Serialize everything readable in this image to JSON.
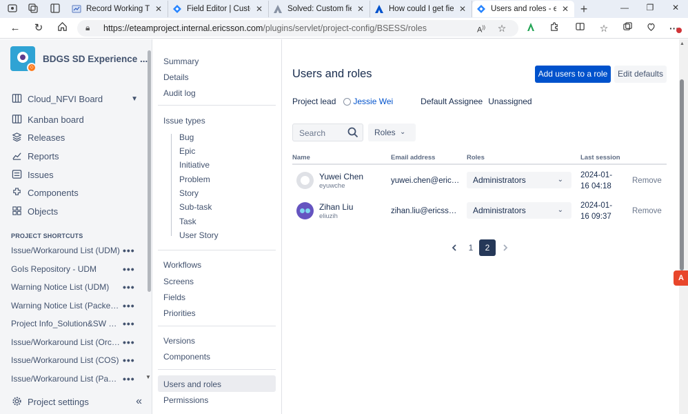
{
  "browser": {
    "tabs": [
      {
        "title": "Record Working Time",
        "icon": "jira-record-icon"
      },
      {
        "title": "Field Editor | Customfie",
        "icon": "jira-diamond-icon"
      },
      {
        "title": "Solved: Custom fields e",
        "icon": "atlassian-community-icon"
      },
      {
        "title": "How could I get field e",
        "icon": "atlassian-icon"
      },
      {
        "title": "Users and roles - eTeam",
        "icon": "jira-diamond-icon"
      }
    ],
    "url_host": "https://eteamproject.internal.ericsson.com",
    "url_path": "/plugins/servlet/project-config/BSESS/roles",
    "accent": "#0052cc"
  },
  "sidebar": {
    "project_name": "BDGS SD Experience ...",
    "board": "Cloud_NFVI Board",
    "items": [
      {
        "label": "Kanban board",
        "icon": "kanban-board-icon"
      },
      {
        "label": "Releases",
        "icon": "releases-icon"
      },
      {
        "label": "Reports",
        "icon": "reports-icon"
      },
      {
        "label": "Issues",
        "icon": "issues-icon"
      },
      {
        "label": "Components",
        "icon": "components-icon"
      },
      {
        "label": "Objects",
        "icon": "objects-icon"
      }
    ],
    "shortcuts_heading": "PROJECT SHORTCUTS",
    "shortcuts": [
      "Issue/Workaround List (UDM)",
      "GoIs Repository - UDM",
      "Warning Notice List (UDM)",
      "Warning Notice List (Packet Core)",
      "Project Info_Solution&SW Versio...",
      "Issue/Workaround List (Orchestr...",
      "Issue/Workaround List (COS)",
      "Issue/Workaround List (Packet C..."
    ],
    "settings": "Project settings"
  },
  "settings_nav": {
    "top": [
      "Summary",
      "Details",
      "Audit log"
    ],
    "issue_types_heading": "Issue types",
    "issue_types": [
      "Bug",
      "Epic",
      "Initiative",
      "Problem",
      "Story",
      "Sub-task",
      "Task",
      "User Story"
    ],
    "group2": [
      "Workflows",
      "Screens",
      "Fields",
      "Priorities"
    ],
    "group3": [
      "Versions",
      "Components"
    ],
    "group4": [
      "Users and roles",
      "Permissions"
    ]
  },
  "main": {
    "title": "Users and roles",
    "add_users_button": "Add users to a role",
    "edit_defaults_button": "Edit defaults",
    "project_lead_label": "Project lead",
    "project_lead": "Jessie Wei",
    "default_assignee_label": "Default Assignee",
    "default_assignee": "Unassigned",
    "search_placeholder": "Search",
    "roles_filter": "Roles",
    "columns": [
      "Name",
      "Email address",
      "Roles",
      "Last session"
    ],
    "users": [
      {
        "name": "Yuwei Chen",
        "id": "eyuwche",
        "email": "yuwei.chen@ericsson.com",
        "role": "Administrators",
        "last_session_date": "2024-01-",
        "last_session_time": "16 04:18",
        "remove": "Remove"
      },
      {
        "name": "Zihan Liu",
        "id": "eliuzih",
        "email": "zihan.liu@ericsson.com",
        "role": "Administrators",
        "last_session_date": "2024-01-",
        "last_session_time": "16 09:37",
        "remove": "Remove"
      }
    ],
    "pagination": {
      "pages": [
        "1",
        "2"
      ],
      "current": "2"
    }
  }
}
